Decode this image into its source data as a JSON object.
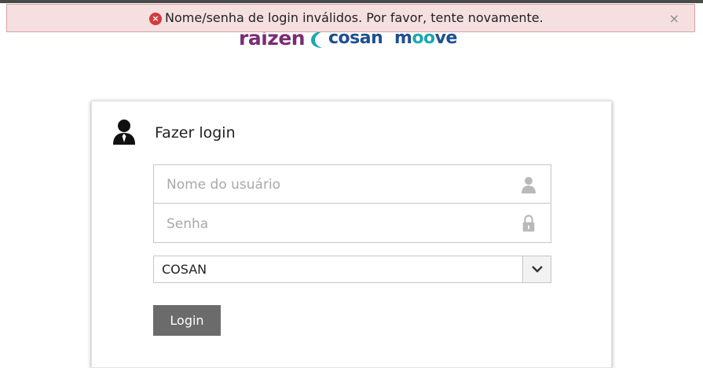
{
  "alert": {
    "message": "Nome/senha de login inválidos. Por favor, tente novamente.",
    "close_glyph": "×",
    "error_glyph": "×",
    "color": "#f6dfe0"
  },
  "logos": {
    "raizen": "raízen",
    "cosan": "cosan",
    "moove_m": "m",
    "moove_oo": "oo",
    "moove_ve": "ve"
  },
  "login": {
    "title": "Fazer login",
    "username_placeholder": "Nome do usuário",
    "password_placeholder": "Senha",
    "domain_selected": "COSAN",
    "submit_label": "Login"
  },
  "icons": {
    "alert": "error-circle-icon",
    "close": "close-icon",
    "avatar": "user-avatar-icon",
    "username": "user-icon",
    "password": "lock-icon",
    "dropdown": "chevron-down-icon"
  },
  "colors": {
    "button": "#6b6b6b",
    "raizen": "#7b2d73",
    "cosan": "#1d4f91",
    "moove_accent": "#1aa9b0"
  }
}
